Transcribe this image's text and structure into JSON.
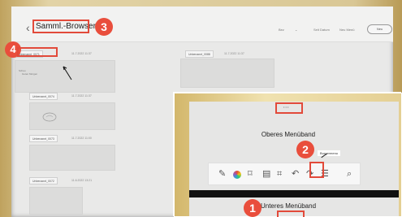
{
  "app": {
    "title": "Samml.-Browser",
    "back_glyph": "‹"
  },
  "topbar": {
    "sort_label": "Bez",
    "chevron": "⌄",
    "copy_label": "Seit Datum",
    "new_label": "Neu Menü",
    "new_button": "Neu"
  },
  "cards_left": [
    {
      "tag": "Unbenannt_0071",
      "date": "11.7.2022 11:37",
      "line1": "Schau",
      "line2": "Guten Morgen"
    },
    {
      "tag": "Unbenannt_0074",
      "date": "11.7.2022 11:37"
    },
    {
      "tag": "Unbenannt_0073",
      "date": "11.7.2022 11:00"
    },
    {
      "tag": "Unbenannt_0072",
      "date": "11.6.2022 13:21"
    }
  ],
  "cards_right": [
    {
      "tag": "Unbenannt_0088",
      "date": "11.7.2022 11:37"
    }
  ],
  "annotations": {
    "one": "1",
    "two": "2",
    "three": "3",
    "four": "4"
  },
  "inset": {
    "handle": "• • •",
    "top_label": "Oberes Menüband",
    "bottom_label": "Unteres Menüband",
    "tooltip": "Burgermenu",
    "tools": [
      "pen-icon",
      "color-wheel-icon",
      "shape-select-icon",
      "document-icon",
      "crop-icon",
      "undo-icon",
      "redo-icon",
      "hamburger-menu-icon",
      "search-icon"
    ]
  },
  "colors": {
    "annotation_red": "#e94e3c",
    "bezel_gold": "#d9c795"
  }
}
